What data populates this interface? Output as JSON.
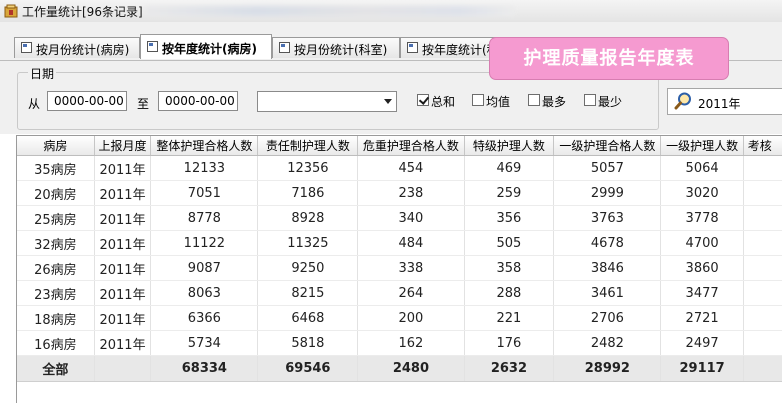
{
  "window": {
    "title": "工作量统计[96条记录]",
    "icon": "app-folder-icon"
  },
  "tabs": [
    {
      "label": "按月份统计(病房)",
      "active": false
    },
    {
      "label": "按年度统计(病房)",
      "active": true
    },
    {
      "label": "按月份统计(科室)",
      "active": false
    },
    {
      "label": "按年度统计(科室)",
      "active": false
    }
  ],
  "callout": "护理质量报告年度表",
  "filter": {
    "group_label": "日期",
    "from_label": "从",
    "to_label": "至",
    "from_value": "0000-00-00",
    "to_value": "0000-00-00",
    "combo_value": "",
    "checkboxes": [
      {
        "label": "总和",
        "checked": true
      },
      {
        "label": "均值",
        "checked": false
      },
      {
        "label": "最多",
        "checked": false
      },
      {
        "label": "最少",
        "checked": false
      }
    ],
    "year_value": "2011年"
  },
  "table": {
    "columns": [
      "病房",
      "上报月度",
      "整体护理合格人数",
      "责任制护理人数",
      "危重护理合格人数",
      "特级护理人数",
      "一级护理合格人数",
      "一级护理人数",
      "考核"
    ],
    "rows": [
      [
        "35病房",
        "2011年",
        "12133",
        "12356",
        "454",
        "469",
        "5057",
        "5064",
        ""
      ],
      [
        "20病房",
        "2011年",
        "7051",
        "7186",
        "238",
        "259",
        "2999",
        "3020",
        ""
      ],
      [
        "25病房",
        "2011年",
        "8778",
        "8928",
        "340",
        "356",
        "3763",
        "3778",
        ""
      ],
      [
        "32病房",
        "2011年",
        "11122",
        "11325",
        "484",
        "505",
        "4678",
        "4700",
        ""
      ],
      [
        "26病房",
        "2011年",
        "9087",
        "9250",
        "338",
        "358",
        "3846",
        "3860",
        ""
      ],
      [
        "23病房",
        "2011年",
        "8063",
        "8215",
        "264",
        "288",
        "3461",
        "3477",
        ""
      ],
      [
        "18病房",
        "2011年",
        "6366",
        "6468",
        "200",
        "221",
        "2706",
        "2721",
        ""
      ],
      [
        "16病房",
        "2011年",
        "5734",
        "5818",
        "162",
        "176",
        "2482",
        "2497",
        ""
      ]
    ],
    "total": [
      "全部",
      "",
      "68334",
      "69546",
      "2480",
      "2632",
      "28992",
      "29117",
      ""
    ]
  }
}
